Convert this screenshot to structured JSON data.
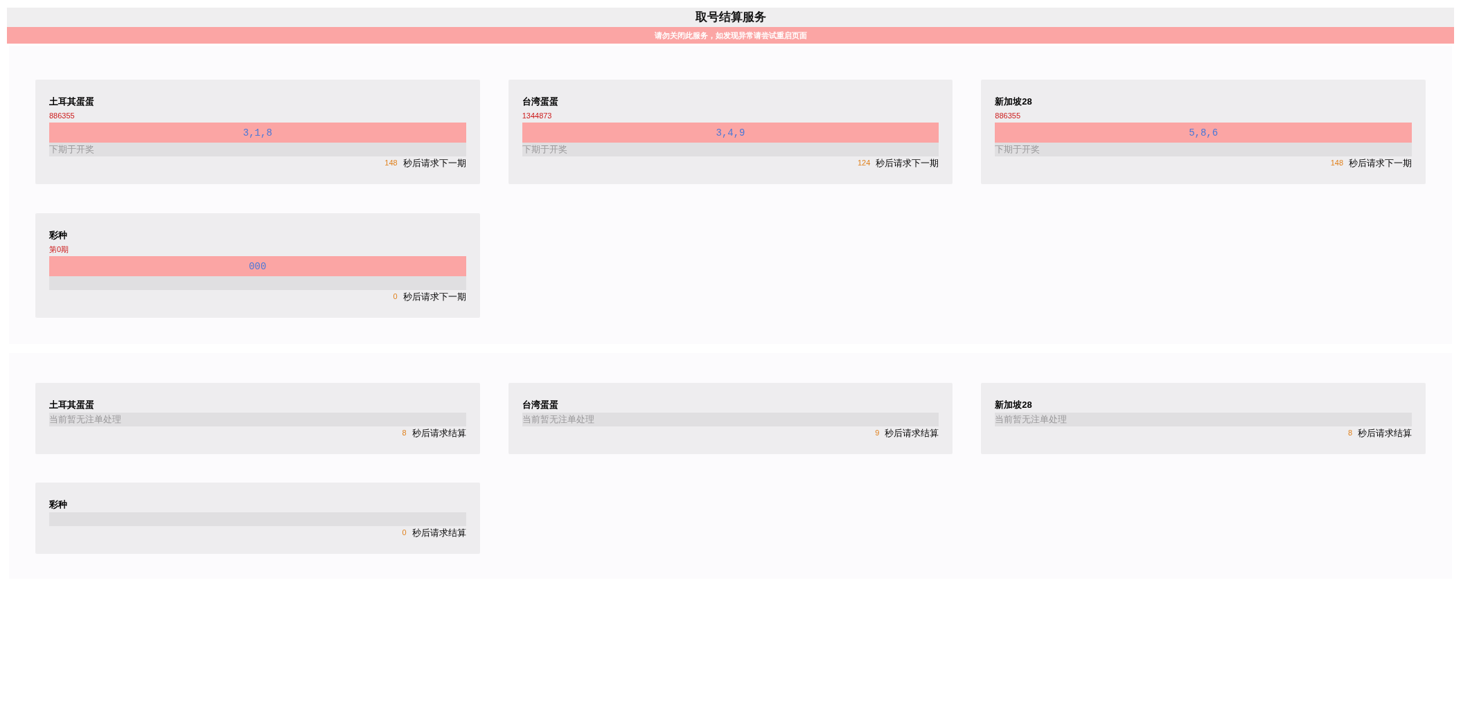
{
  "header": {
    "title": "取号结算服务",
    "notice": "请勿关闭此服务，如发现异常请尝试重启页面"
  },
  "draw_panel": {
    "cards": [
      {
        "name": "土耳其蛋蛋",
        "issue": "886355",
        "numbers": "3,1,8",
        "next_draw": "下期于开奖",
        "countdown": "148",
        "countdown_label": "秒后请求下一期"
      },
      {
        "name": "台湾蛋蛋",
        "issue": "1344873",
        "numbers": "3,4,9",
        "next_draw": "下期于开奖",
        "countdown": "124",
        "countdown_label": "秒后请求下一期"
      },
      {
        "name": "新加坡28",
        "issue": "886355",
        "numbers": "5,8,6",
        "next_draw": "下期于开奖",
        "countdown": "148",
        "countdown_label": "秒后请求下一期"
      },
      {
        "name": "彩种",
        "issue": "第0期",
        "numbers": "000",
        "countdown": "0",
        "countdown_label": "秒后请求下一期"
      }
    ]
  },
  "settle_panel": {
    "cards": [
      {
        "name": "土耳其蛋蛋",
        "status": "当前暂无注单处理",
        "countdown": "8",
        "countdown_label": "秒后请求结算"
      },
      {
        "name": "台湾蛋蛋",
        "status": "当前暂无注单处理",
        "countdown": "9",
        "countdown_label": "秒后请求结算"
      },
      {
        "name": "新加坡28",
        "status": "当前暂无注单处理",
        "countdown": "8",
        "countdown_label": "秒后请求结算"
      },
      {
        "name": "彩种",
        "countdown": "0",
        "countdown_label": "秒后请求结算"
      }
    ]
  }
}
